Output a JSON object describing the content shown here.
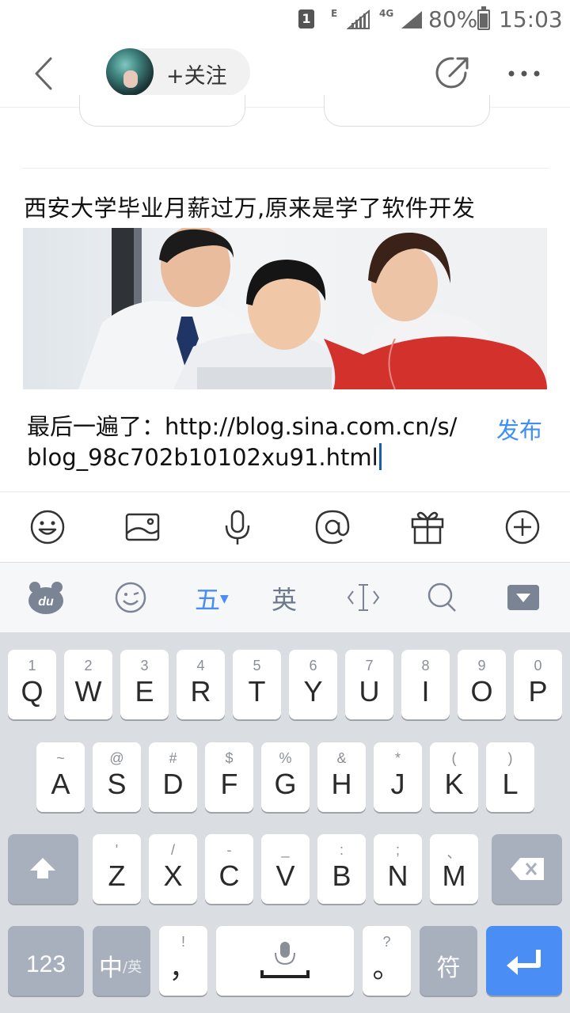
{
  "status_bar": {
    "sim_badge": "1",
    "net_e": "E",
    "net_4g": "4G",
    "battery": "80%",
    "time": "15:03"
  },
  "nav": {
    "follow_label": "+关注"
  },
  "article": {
    "headline": "西安大学毕业月薪过万,原来是学了软件开发"
  },
  "composer": {
    "text": "最后一遍了：http://blog.sina.com.cn/s/blog_98c702b10102xu91.html",
    "publish_label": "发布"
  },
  "toolbar": {
    "icons": [
      "emoji-icon",
      "image-icon",
      "microphone-icon",
      "at-icon",
      "gift-icon",
      "add-icon"
    ]
  },
  "ime": {
    "wubi_label": "五",
    "english_label": "英"
  },
  "keyboard": {
    "row1": [
      {
        "hint": "1",
        "key": "Q"
      },
      {
        "hint": "2",
        "key": "W"
      },
      {
        "hint": "3",
        "key": "E"
      },
      {
        "hint": "4",
        "key": "R"
      },
      {
        "hint": "5",
        "key": "T"
      },
      {
        "hint": "6",
        "key": "Y"
      },
      {
        "hint": "7",
        "key": "U"
      },
      {
        "hint": "8",
        "key": "I"
      },
      {
        "hint": "9",
        "key": "O"
      },
      {
        "hint": "0",
        "key": "P"
      }
    ],
    "row2": [
      {
        "hint": "~",
        "key": "A"
      },
      {
        "hint": "@",
        "key": "S"
      },
      {
        "hint": "#",
        "key": "D"
      },
      {
        "hint": "$",
        "key": "F"
      },
      {
        "hint": "%",
        "key": "G"
      },
      {
        "hint": "&",
        "key": "H"
      },
      {
        "hint": "*",
        "key": "J"
      },
      {
        "hint": "(",
        "key": "K"
      },
      {
        "hint": ")",
        "key": "L"
      }
    ],
    "row3": [
      {
        "hint": "'",
        "key": "Z"
      },
      {
        "hint": "/",
        "key": "X"
      },
      {
        "hint": "-",
        "key": "C"
      },
      {
        "hint": "_",
        "key": "V"
      },
      {
        "hint": ":",
        "key": "B"
      },
      {
        "hint": ";",
        "key": "N"
      },
      {
        "hint": "、",
        "key": "M"
      }
    ],
    "num_label": "123",
    "lang_main": "中",
    "lang_sub": "/英",
    "comma_hint": "!",
    "comma_key": "，",
    "period_hint": "?",
    "period_key": "。",
    "symbol_label": "符"
  }
}
